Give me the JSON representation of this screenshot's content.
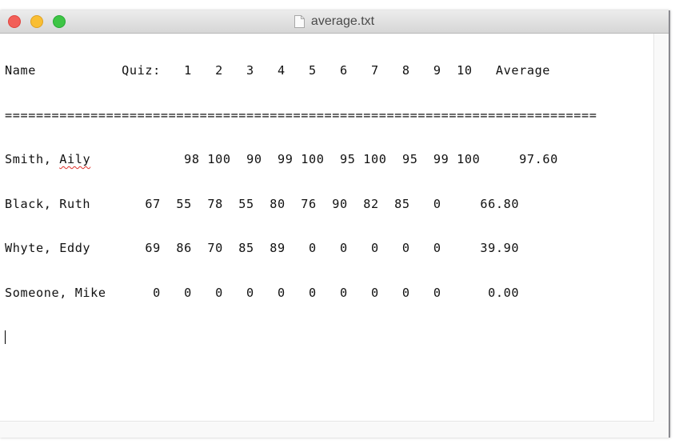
{
  "window": {
    "title": "average.txt",
    "file_icon": "document-icon",
    "controls": {
      "close": "close-button",
      "minimize": "minimize-button",
      "zoom": "zoom-button"
    }
  },
  "document": {
    "header_line": "Name           Quiz:   1   2   3   4   5   6   7   8   9  10   Average",
    "separator_line": "============================================================================",
    "rows": [
      {
        "name": "Smith, Aily",
        "pre": "Smith, ",
        "misspelled": "Aily",
        "scores_text": "            98 100  90  99 100  95 100  95  99 100     97.60"
      },
      {
        "name": "Black, Ruth",
        "scores_text": "Black, Ruth       67  55  78  55  80  76  90  82  85   0     66.80"
      },
      {
        "name": "Whyte, Eddy",
        "scores_text": "Whyte, Eddy       69  86  70  85  89   0   0   0   0   0     39.90"
      },
      {
        "name": "Someone, Mike",
        "scores_text": "Someone, Mike      0   0   0   0   0   0   0   0   0   0      0.00"
      }
    ],
    "table": {
      "columns": [
        "Name",
        "1",
        "2",
        "3",
        "4",
        "5",
        "6",
        "7",
        "8",
        "9",
        "10",
        "Average"
      ],
      "data": [
        [
          "Smith, Aily",
          98,
          100,
          90,
          99,
          100,
          95,
          100,
          95,
          99,
          100,
          "97.60"
        ],
        [
          "Black, Ruth",
          67,
          55,
          78,
          55,
          80,
          76,
          90,
          82,
          85,
          0,
          "66.80"
        ],
        [
          "Whyte, Eddy",
          69,
          86,
          70,
          85,
          89,
          0,
          0,
          0,
          0,
          0,
          "39.90"
        ],
        [
          "Someone, Mike",
          0,
          0,
          0,
          0,
          0,
          0,
          0,
          0,
          0,
          0,
          "0.00"
        ]
      ]
    }
  },
  "colors": {
    "close": "#f25f58",
    "minimize": "#f9be33",
    "zoom": "#3ec545",
    "spellcheck": "#e0302a"
  }
}
